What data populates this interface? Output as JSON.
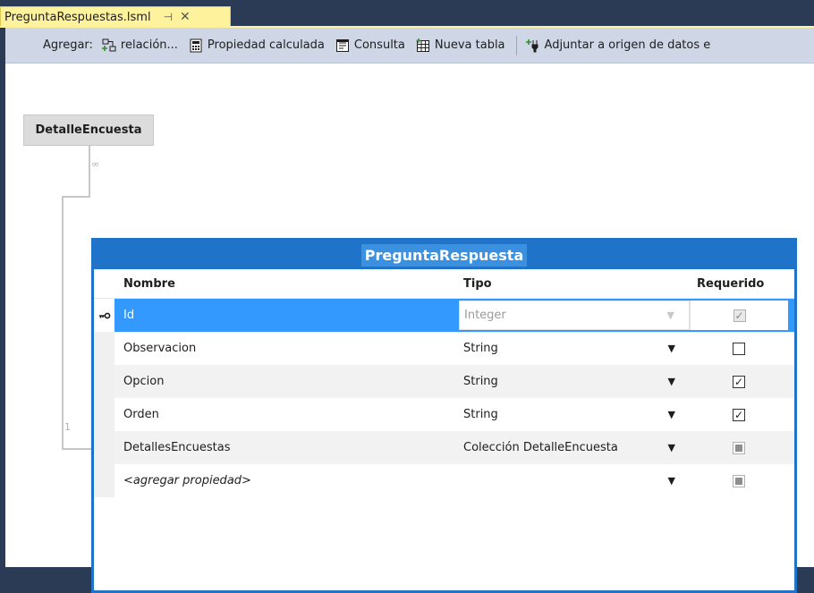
{
  "tab": {
    "title": "PreguntaRespuestas.lsml",
    "pin": "⊣",
    "close": "✕"
  },
  "toolbar": {
    "label": "Agregar:",
    "buttons": [
      {
        "label": "relación...",
        "icon": "add-relationship-icon"
      },
      {
        "label": "Propiedad calculada",
        "icon": "computed-property-icon"
      },
      {
        "label": "Consulta",
        "icon": "query-icon"
      },
      {
        "label": "Nueva tabla",
        "icon": "new-table-icon"
      },
      {
        "label": "Adjuntar a origen de datos e",
        "icon": "attach-datasource-icon"
      }
    ]
  },
  "related_entity": {
    "name": "DetalleEncuesta",
    "multiplicity_top": "∞",
    "multiplicity_bottom": "1"
  },
  "entity": {
    "title": "PreguntaRespuesta",
    "columns": {
      "name": "Nombre",
      "type": "Tipo",
      "required": "Requerido"
    },
    "rows": [
      {
        "name": "Id",
        "type": "Integer",
        "required": "checked-disabled",
        "key_icon": "key-icon"
      },
      {
        "name": "Observacion",
        "type": "String",
        "required": "unchecked"
      },
      {
        "name": "Opcion",
        "type": "String",
        "required": "checked"
      },
      {
        "name": "Orden",
        "type": "String",
        "required": "checked"
      },
      {
        "name": "DetallesEncuestas",
        "type": "Colección DetalleEncuesta",
        "required": "indeterminate"
      },
      {
        "name": "<agregar propiedad>",
        "type": "",
        "required": "indeterminate"
      }
    ]
  },
  "colors": {
    "accent": "#1f73c9",
    "selection": "#3399ff",
    "tab": "#fef29c",
    "chrome": "#2b3a55"
  }
}
